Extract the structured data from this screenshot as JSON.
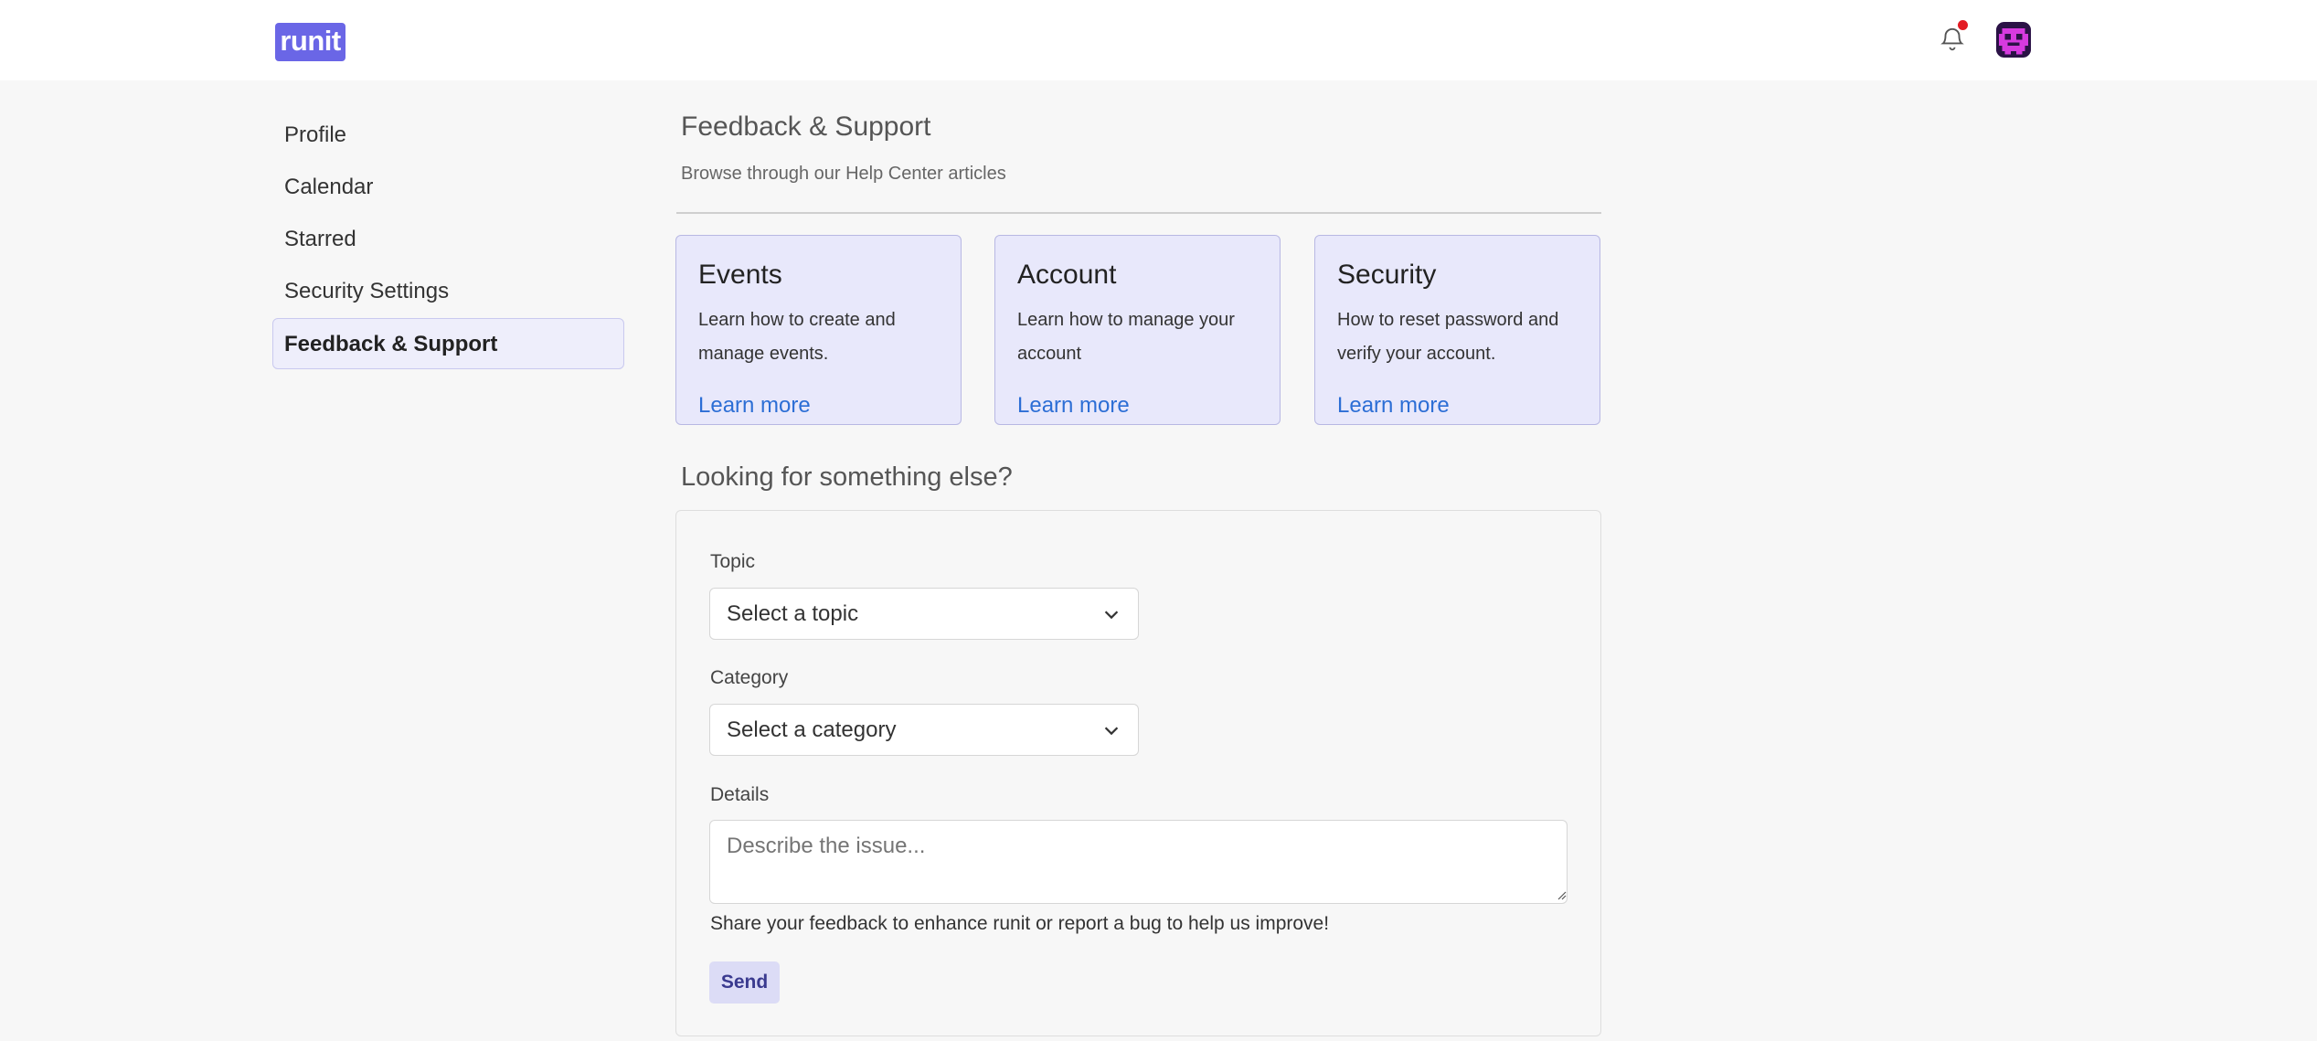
{
  "header": {
    "logo_text": "runit",
    "icons": [
      "bell-icon",
      "notification-dot",
      "avatar"
    ],
    "colors": {
      "brand": "#6a66e6",
      "notification": "#e31b23"
    }
  },
  "sidebar": {
    "items": [
      {
        "label": "Profile",
        "active": false
      },
      {
        "label": "Calendar",
        "active": false
      },
      {
        "label": "Starred",
        "active": false
      },
      {
        "label": "Security Settings",
        "active": false
      },
      {
        "label": "Feedback & Support",
        "active": true
      }
    ]
  },
  "main": {
    "title": "Feedback & Support",
    "subtitle": "Browse through our Help Center articles",
    "cards": [
      {
        "title": "Events",
        "description": "Learn how to create and manage events.",
        "link": "Learn more"
      },
      {
        "title": "Account",
        "description": "Learn how to manage your account",
        "link": "Learn more"
      },
      {
        "title": "Security",
        "description": "How to reset password and verify your account.",
        "link": "Learn more"
      }
    ],
    "section_title": "Looking for something else?",
    "form": {
      "topic_label": "Topic",
      "topic_value": "Select a topic",
      "category_label": "Category",
      "category_value": "Select a category",
      "details_label": "Details",
      "details_placeholder": "Describe the issue...",
      "help_text": "Share your feedback to enhance runit or report a bug to help us improve!",
      "send_label": "Send"
    }
  }
}
